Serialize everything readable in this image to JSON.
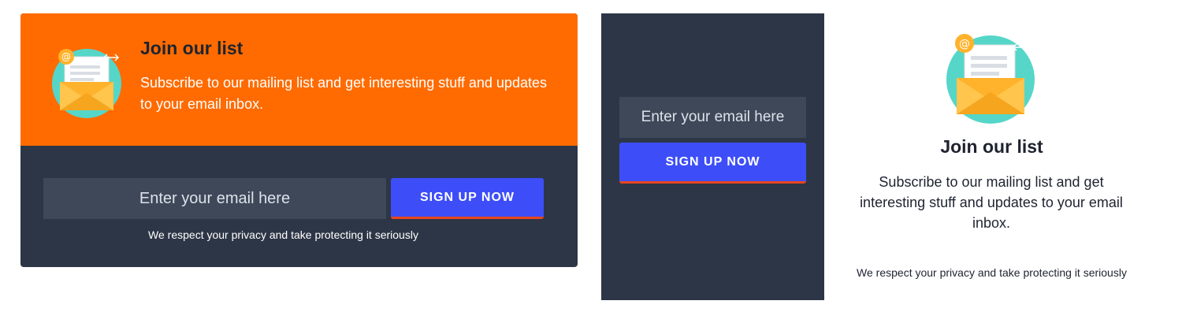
{
  "card_large": {
    "title": "Join our list",
    "description": "Subscribe to our mailing list and get interesting stuff and updates to your email inbox.",
    "email_placeholder": "Enter your email here",
    "signup_label": "SIGN UP NOW",
    "privacy": "We respect your privacy and take protecting it seriously",
    "icon": "envelope-icon"
  },
  "card_compact": {
    "email_placeholder": "Enter your email here",
    "signup_label": "SIGN UP NOW"
  },
  "card_light": {
    "title": "Join our list",
    "description": "Subscribe to our mailing list and get interesting stuff and updates to your email inbox.",
    "privacy": "We respect your privacy and take protecting it seriously",
    "icon": "envelope-icon"
  },
  "colors": {
    "orange": "#ff6b00",
    "navy": "#2d3646",
    "input_bg": "#3e4859",
    "button_blue": "#3d4ef8",
    "button_underline": "#e8461f"
  }
}
